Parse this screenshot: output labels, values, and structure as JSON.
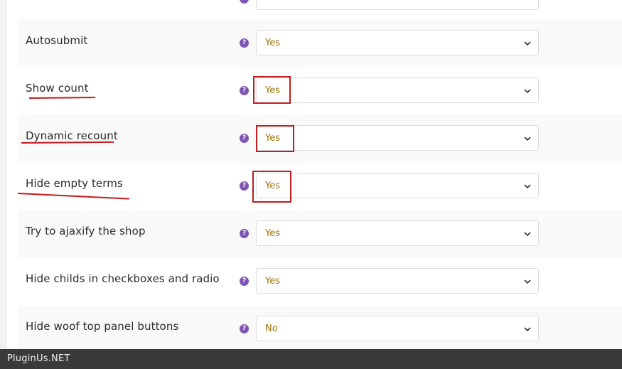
{
  "settings": [
    {
      "label": "Autosubmit",
      "value": "Yes"
    },
    {
      "label": "Show count",
      "value": "Yes"
    },
    {
      "label": "Dynamic recount",
      "value": "Yes"
    },
    {
      "label": "Hide empty terms",
      "value": "Yes"
    },
    {
      "label": "Try to ajaxify the shop",
      "value": "Yes"
    },
    {
      "label": "Hide childs in checkboxes and radio",
      "value": "Yes"
    },
    {
      "label": "Hide woof top panel buttons",
      "value": "No"
    }
  ],
  "help_glyph": "?",
  "footer": {
    "brand": "PluginUs.NET"
  },
  "colors": {
    "accent_purple": "#7f54b3",
    "value_text": "#a0700a",
    "annotation_red": "#c41b1b"
  }
}
